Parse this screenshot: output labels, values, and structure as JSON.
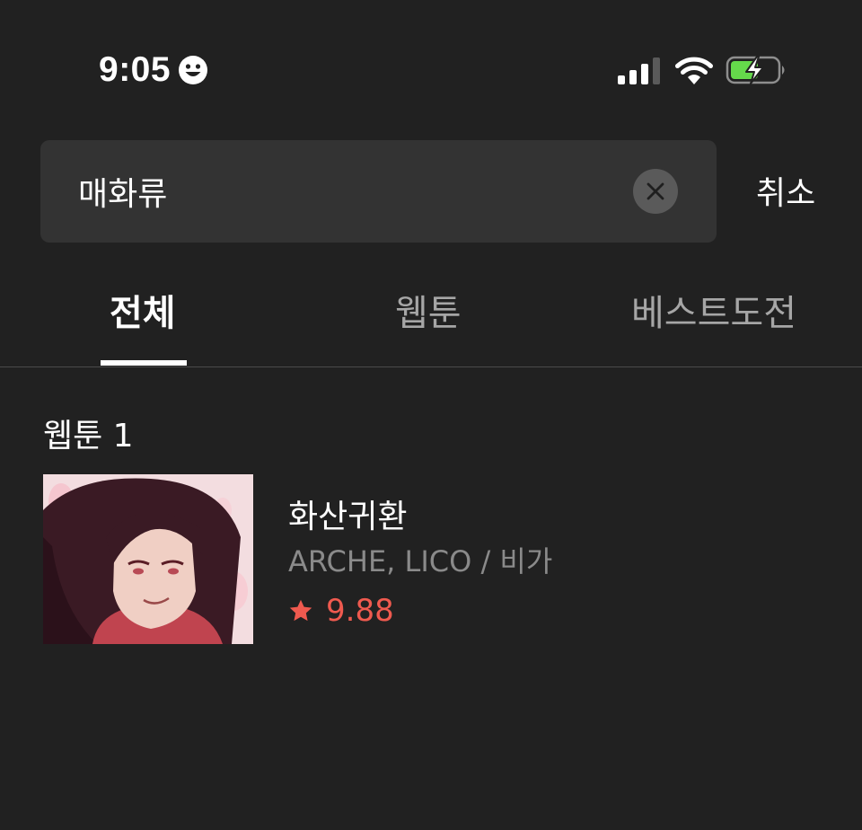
{
  "status_bar": {
    "time": "9:05",
    "focus_icon": "smiley-face-icon",
    "signal_icon": "cellular-signal-icon",
    "wifi_icon": "wifi-icon",
    "battery_icon": "battery-charging-icon",
    "battery_color": "#65d94b"
  },
  "search": {
    "value": "매화류",
    "placeholder": "",
    "clear_icon": "close-icon",
    "cancel_label": "취소"
  },
  "tabs": [
    {
      "label": "전체",
      "active": true
    },
    {
      "label": "웹툰",
      "active": false
    },
    {
      "label": "베스트도전",
      "active": false
    }
  ],
  "section": {
    "title": "웹툰 1"
  },
  "results": [
    {
      "title": "화산귀환",
      "authors": "ARCHE, LICO / 비가",
      "rating": "9.88",
      "rating_icon": "star-icon",
      "rating_color": "#ef5a4f"
    }
  ],
  "colors": {
    "background": "#212121",
    "search_box": "#333333",
    "inactive_tab": "#a6a6a6",
    "secondary_text": "#8a8a8a"
  }
}
